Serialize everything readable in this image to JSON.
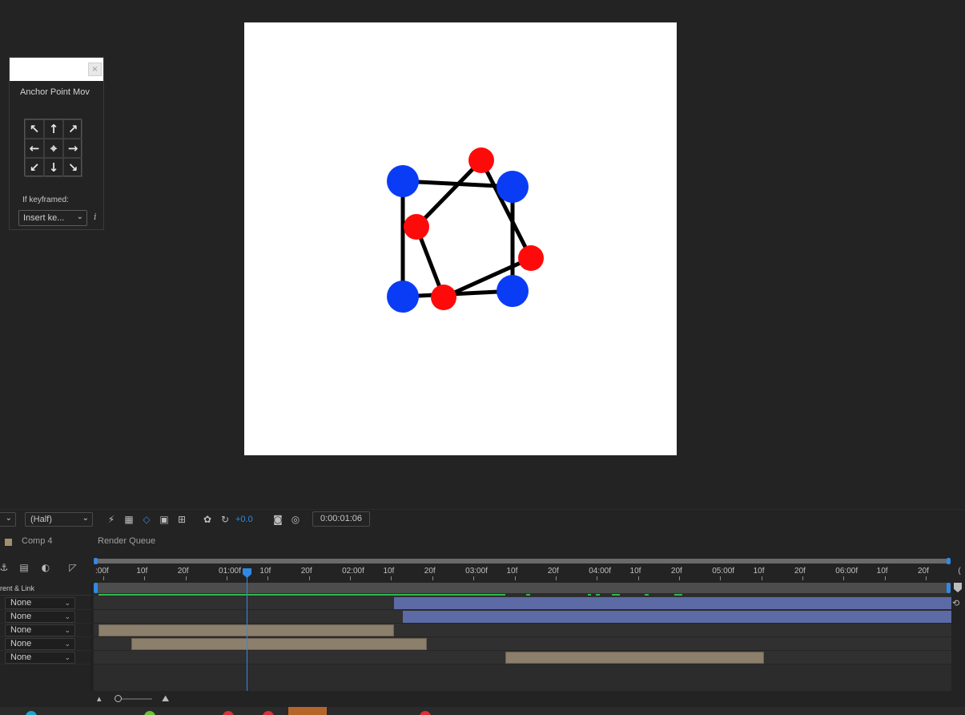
{
  "anchor_panel": {
    "title": "Anchor Point Mov",
    "close_glyph": "×",
    "arrows": [
      "↖",
      "↑",
      "↗",
      "←",
      "⌖",
      "→",
      "↙",
      "↓",
      "↘"
    ],
    "keyframed_label": "If keyframed:",
    "keyframed_select": "Insert ke...",
    "info_glyph": "i"
  },
  "viewer_toolbar": {
    "left_drop": "",
    "resolution": "(Half)",
    "exposure": "+0.0",
    "timecode": "0:00:01:06"
  },
  "timeline": {
    "tabs": [
      "Comp 4",
      "Render Queue"
    ],
    "column_header": "rent & Link",
    "ruler_labels": [
      ":00f",
      "10f",
      "20f",
      "01:00f",
      "10f",
      "20f",
      "02:00f",
      "10f",
      "20f",
      "03:00f",
      "10f",
      "20f",
      "04:00f",
      "10f",
      "20f",
      "05:00f",
      "10f",
      "20f",
      "06:00f",
      "10f",
      "20f",
      "("
    ],
    "parents": [
      "None",
      "None",
      "None",
      "None",
      "None"
    ]
  },
  "colors": {
    "canvas_bg": "#ffffff",
    "blue_node": "#0a3cf5",
    "red_node": "#ff0a0a",
    "edge": "#000000",
    "accent": "#2e8ae6",
    "layer_purple": "#5c6aa6",
    "layer_tan": "#8c7f6b",
    "cache_green": "#2db84d"
  }
}
